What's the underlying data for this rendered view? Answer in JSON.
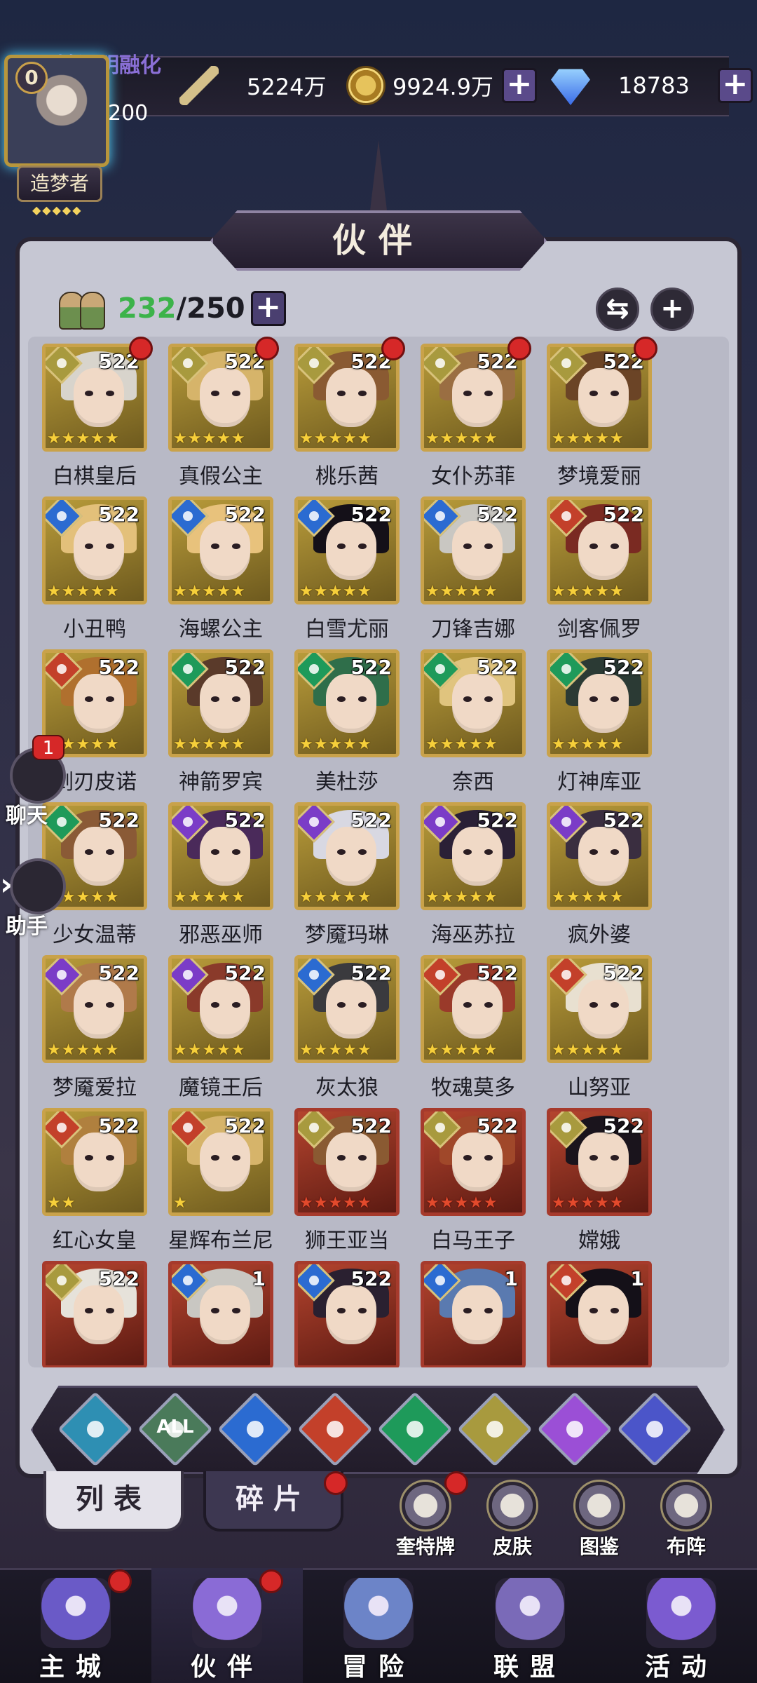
{
  "header": {
    "marquee": "不够证明融化",
    "avatar_level_badge": "0",
    "player_level": "200",
    "title_tag": "造梦者",
    "title_stars": "◆◆◆◆◆",
    "resources": {
      "power": "5224万",
      "gold": "9924.9万",
      "gems": "18783"
    },
    "plus": "+"
  },
  "panel": {
    "title": "伙伴",
    "capacity_current": "232",
    "capacity_max": "/250",
    "capacity_plus": "+",
    "swap_icon": "⇆",
    "add_icon": "+"
  },
  "heroes": [
    {
      "name": "白棋皇后",
      "level": "522",
      "element": "light",
      "dot": true,
      "stars": "★★★★★",
      "frame": "gold",
      "hair": "#d8d4cc"
    },
    {
      "name": "真假公主",
      "level": "522",
      "element": "light",
      "dot": true,
      "stars": "★★★★★",
      "frame": "gold",
      "hair": "#d6b46a"
    },
    {
      "name": "桃乐茜",
      "level": "522",
      "element": "light",
      "dot": true,
      "stars": "★★★★★",
      "frame": "gold",
      "hair": "#8a5a32"
    },
    {
      "name": "女仆苏菲",
      "level": "522",
      "element": "light",
      "dot": true,
      "stars": "★★★★★",
      "frame": "gold",
      "hair": "#9a6e42"
    },
    {
      "name": "梦境爱丽",
      "level": "522",
      "element": "light",
      "dot": true,
      "stars": "★★★★★",
      "frame": "gold",
      "hair": "#6b4426"
    },
    {
      "name": "小丑鸭",
      "level": "522",
      "element": "water",
      "dot": false,
      "stars": "★★★★★",
      "frame": "gold",
      "hair": "#e3c07a"
    },
    {
      "name": "海螺公主",
      "level": "522",
      "element": "water",
      "dot": false,
      "stars": "★★★★★",
      "frame": "gold",
      "hair": "#e8c27c"
    },
    {
      "name": "白雪尤丽",
      "level": "522",
      "element": "water",
      "dot": false,
      "stars": "★★★★★",
      "frame": "gold",
      "hair": "#141018"
    },
    {
      "name": "刀锋吉娜",
      "level": "522",
      "element": "water",
      "dot": false,
      "stars": "★★★★★",
      "frame": "gold",
      "hair": "#c9c7c2"
    },
    {
      "name": "剑客佩罗",
      "level": "522",
      "element": "fire",
      "dot": false,
      "stars": "★★★★★",
      "frame": "gold",
      "hair": "#7a2a22"
    },
    {
      "name": "剑刃皮诺",
      "level": "522",
      "element": "fire",
      "dot": false,
      "stars": "★★★★★",
      "frame": "gold",
      "hair": "#b0702e"
    },
    {
      "name": "神箭罗宾",
      "level": "522",
      "element": "wind",
      "dot": false,
      "stars": "★★★★★",
      "frame": "gold",
      "hair": "#5a3a2a"
    },
    {
      "name": "美杜莎",
      "level": "522",
      "element": "wind",
      "dot": false,
      "stars": "★★★★★",
      "frame": "gold",
      "hair": "#2f6e4a"
    },
    {
      "name": "奈西",
      "level": "522",
      "element": "wind",
      "dot": false,
      "stars": "★★★★★",
      "frame": "gold",
      "hair": "#e0c47e"
    },
    {
      "name": "灯神库亚",
      "level": "522",
      "element": "wind",
      "dot": false,
      "stars": "★★★★★",
      "frame": "gold",
      "hair": "#2b3a34"
    },
    {
      "name": "少女温蒂",
      "level": "522",
      "element": "wind",
      "dot": false,
      "stars": "★★★★★",
      "frame": "gold",
      "hair": "#8a5a36"
    },
    {
      "name": "邪恶巫师",
      "level": "522",
      "element": "dark",
      "dot": false,
      "stars": "★★★★★",
      "frame": "gold",
      "hair": "#4a2a5a"
    },
    {
      "name": "梦魇玛琳",
      "level": "522",
      "element": "dark",
      "dot": false,
      "stars": "★★★★★",
      "frame": "gold",
      "hair": "#d8d8e2"
    },
    {
      "name": "海巫苏拉",
      "level": "522",
      "element": "dark",
      "dot": false,
      "stars": "★★★★★",
      "frame": "gold",
      "hair": "#2a2036"
    },
    {
      "name": "疯外婆",
      "level": "522",
      "element": "dark",
      "dot": false,
      "stars": "★★★★★",
      "frame": "gold",
      "hair": "#3a2e40"
    },
    {
      "name": "梦魇爱拉",
      "level": "522",
      "element": "dark",
      "dot": false,
      "stars": "★★★★★",
      "frame": "gold",
      "hair": "#b07a4a"
    },
    {
      "name": "魔镜王后",
      "level": "522",
      "element": "dark",
      "dot": false,
      "stars": "★★★★★",
      "frame": "gold",
      "hair": "#8a3a2a"
    },
    {
      "name": "灰太狼",
      "level": "522",
      "element": "water",
      "dot": false,
      "stars": "★★★★★",
      "frame": "gold",
      "hair": "#3a3a3e"
    },
    {
      "name": "牧魂莫多",
      "level": "522",
      "element": "fire",
      "dot": false,
      "stars": "★★★★★",
      "frame": "gold",
      "hair": "#9a3a2a"
    },
    {
      "name": "山努亚",
      "level": "522",
      "element": "fire",
      "dot": false,
      "stars": "★★★★★",
      "frame": "gold",
      "hair": "#e8e0d0"
    },
    {
      "name": "红心女皇",
      "level": "522",
      "element": "fire",
      "dot": false,
      "stars": "★★",
      "frame": "gold",
      "hair": "#b0803e"
    },
    {
      "name": "星辉布兰尼",
      "level": "522",
      "element": "fire",
      "dot": false,
      "stars": "★",
      "frame": "gold",
      "hair": "#d6b46a"
    },
    {
      "name": "狮王亚当",
      "level": "522",
      "element": "light",
      "dot": false,
      "stars": "★★★★★",
      "frame": "red",
      "hair": "#8a5a32"
    },
    {
      "name": "白马王子",
      "level": "522",
      "element": "light",
      "dot": false,
      "stars": "★★★★★",
      "frame": "red",
      "hair": "#a0482a"
    },
    {
      "name": "嫦娥",
      "level": "522",
      "element": "light",
      "dot": false,
      "stars": "★★★★★",
      "frame": "red",
      "hair": "#1a141c"
    },
    {
      "name": "",
      "level": "522",
      "element": "light",
      "dot": false,
      "stars": "",
      "frame": "red",
      "hair": "#e6e2da"
    },
    {
      "name": "",
      "level": "1",
      "element": "water",
      "dot": false,
      "stars": "",
      "frame": "red",
      "hair": "#c9c7c2"
    },
    {
      "name": "",
      "level": "522",
      "element": "water",
      "dot": false,
      "stars": "",
      "frame": "red",
      "hair": "#2a2030"
    },
    {
      "name": "",
      "level": "1",
      "element": "water",
      "dot": false,
      "stars": "",
      "frame": "red",
      "hair": "#5a7ab0"
    },
    {
      "name": "",
      "level": "1",
      "element": "fire",
      "dot": false,
      "stars": "",
      "frame": "red",
      "hair": "#141018"
    }
  ],
  "side": {
    "chat_label": "聊天",
    "chat_badge": "1",
    "assist_label": "助手",
    "assist_chevron": "›"
  },
  "filters": [
    {
      "name": "filter-arrow",
      "color": "#2e8fb3"
    },
    {
      "name": "filter-all",
      "color": "#4a7a5a",
      "label": "ALL"
    },
    {
      "name": "filter-water",
      "color": "#2b6bd1"
    },
    {
      "name": "filter-fire",
      "color": "#c3402a"
    },
    {
      "name": "filter-wind",
      "color": "#1e9a5a"
    },
    {
      "name": "filter-light",
      "color": "#a89a3e"
    },
    {
      "name": "filter-dark",
      "color": "#9b4fd6"
    },
    {
      "name": "filter-planet",
      "color": "#4b55c9"
    }
  ],
  "subtabs": {
    "list": "列表",
    "shards": "碎片"
  },
  "tools": [
    {
      "name": "tool-tarot",
      "label": "奎特牌"
    },
    {
      "name": "tool-skin",
      "label": "皮肤"
    },
    {
      "name": "tool-codex",
      "label": "图鉴"
    },
    {
      "name": "tool-formation",
      "label": "布阵"
    }
  ],
  "nav": [
    {
      "name": "nav-main-city",
      "label": "主城",
      "dot": true,
      "color": "#6a5ac7"
    },
    {
      "name": "nav-partners",
      "label": "伙伴",
      "dot": true,
      "color": "#8a6bd6"
    },
    {
      "name": "nav-adventure",
      "label": "冒险",
      "dot": false,
      "color": "#6c84c8"
    },
    {
      "name": "nav-alliance",
      "label": "联盟",
      "dot": false,
      "color": "#7a6ab8"
    },
    {
      "name": "nav-events",
      "label": "活动",
      "dot": false,
      "color": "#7b5bd0"
    }
  ]
}
